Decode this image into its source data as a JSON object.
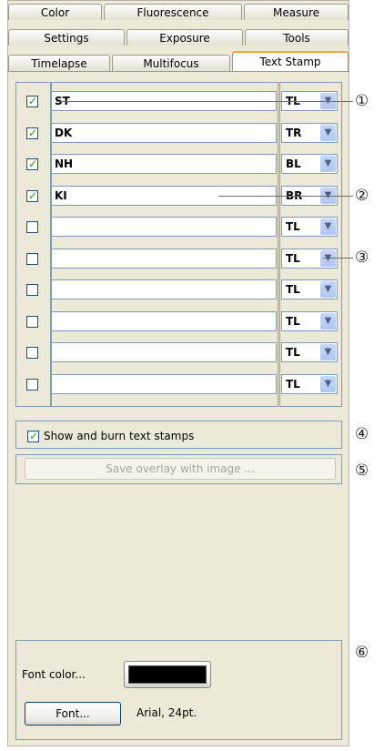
{
  "tabs": {
    "row1": [
      "Color",
      "Fluorescence",
      "Measure"
    ],
    "row2": [
      "Settings",
      "Exposure",
      "Tools"
    ],
    "row3": [
      "Timelapse",
      "Multifocus",
      "Text Stamp"
    ]
  },
  "stamps": [
    {
      "checked": true,
      "text": "ST",
      "position": "TL"
    },
    {
      "checked": true,
      "text": "DK",
      "position": "TR"
    },
    {
      "checked": true,
      "text": "NH",
      "position": "BL"
    },
    {
      "checked": true,
      "text": "KI",
      "position": "BR"
    },
    {
      "checked": false,
      "text": "",
      "position": "TL"
    },
    {
      "checked": false,
      "text": "",
      "position": "TL"
    },
    {
      "checked": false,
      "text": "",
      "position": "TL"
    },
    {
      "checked": false,
      "text": "",
      "position": "TL"
    },
    {
      "checked": false,
      "text": "",
      "position": "TL"
    },
    {
      "checked": false,
      "text": "",
      "position": "TL"
    }
  ],
  "show_burn": {
    "checked": true,
    "label": "Show and burn text stamps"
  },
  "save_overlay_label": "Save overlay with image ...",
  "font_color_label": "Font color...",
  "font_color": "#000000",
  "font_button_label": "Font...",
  "font_value": "Arial, 24pt.",
  "callouts": [
    "①",
    "②",
    "③",
    "④",
    "⑤",
    "⑥"
  ],
  "colors": {
    "accent_tab": "#f2a33a",
    "frame_blue": "#7f9db9",
    "check_green": "#21a121"
  }
}
